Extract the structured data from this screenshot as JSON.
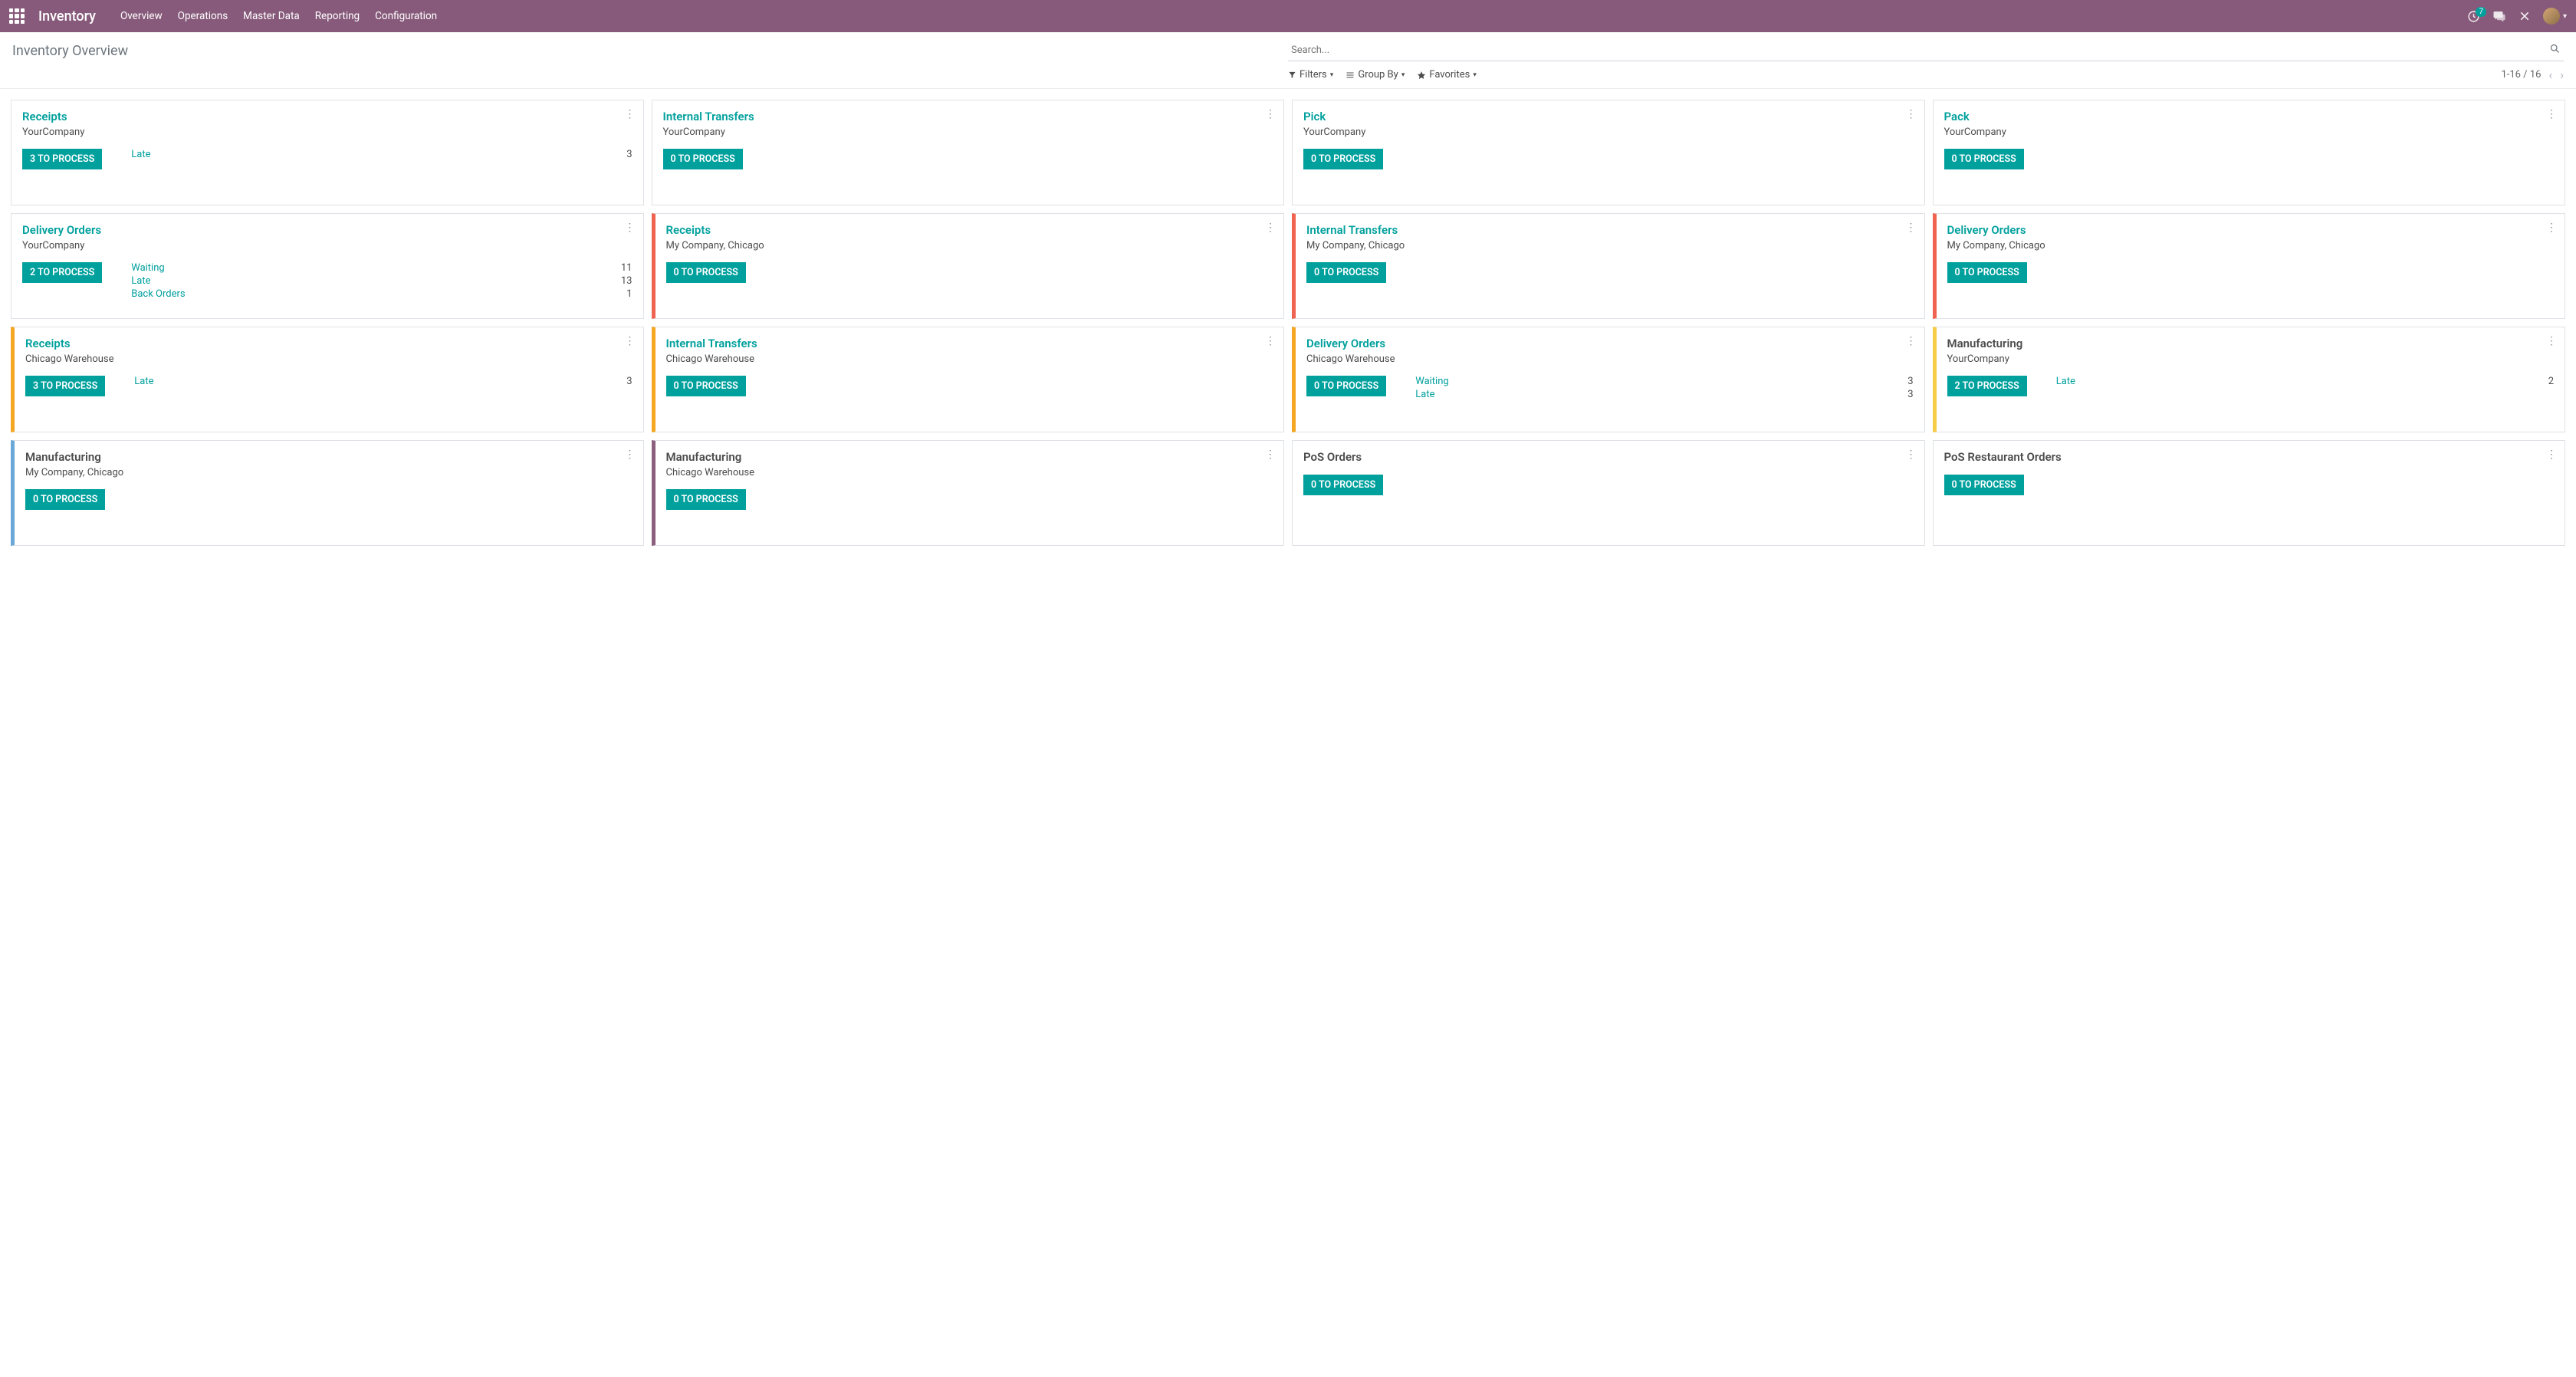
{
  "nav": {
    "brand": "Inventory",
    "menu": [
      "Overview",
      "Operations",
      "Master Data",
      "Reporting",
      "Configuration"
    ],
    "activity_count": "7"
  },
  "control": {
    "breadcrumb": "Inventory Overview",
    "search_placeholder": "Search...",
    "filters": "Filters",
    "groupby": "Group By",
    "favorites": "Favorites",
    "pager": "1-16 / 16"
  },
  "cards": [
    {
      "title": "Receipts",
      "sub": "YourCompany",
      "btn": "3 TO PROCESS",
      "link": true,
      "bar": "",
      "stats": [
        {
          "label": "Late",
          "val": "3"
        }
      ]
    },
    {
      "title": "Internal Transfers",
      "sub": "YourCompany",
      "btn": "0 TO PROCESS",
      "link": true,
      "bar": "",
      "stats": []
    },
    {
      "title": "Pick",
      "sub": "YourCompany",
      "btn": "0 TO PROCESS",
      "link": true,
      "bar": "",
      "stats": []
    },
    {
      "title": "Pack",
      "sub": "YourCompany",
      "btn": "0 TO PROCESS",
      "link": true,
      "bar": "",
      "stats": []
    },
    {
      "title": "Delivery Orders",
      "sub": "YourCompany",
      "btn": "2 TO PROCESS",
      "link": true,
      "bar": "",
      "stats": [
        {
          "label": "Waiting",
          "val": "11"
        },
        {
          "label": "Late",
          "val": "13"
        },
        {
          "label": "Back Orders",
          "val": "1"
        }
      ]
    },
    {
      "title": "Receipts",
      "sub": "My Company, Chicago",
      "btn": "0 TO PROCESS",
      "link": true,
      "bar": "bar-red",
      "stats": []
    },
    {
      "title": "Internal Transfers",
      "sub": "My Company, Chicago",
      "btn": "0 TO PROCESS",
      "link": true,
      "bar": "bar-red",
      "stats": []
    },
    {
      "title": "Delivery Orders",
      "sub": "My Company, Chicago",
      "btn": "0 TO PROCESS",
      "link": true,
      "bar": "bar-red",
      "stats": []
    },
    {
      "title": "Receipts",
      "sub": "Chicago Warehouse",
      "btn": "3 TO PROCESS",
      "link": true,
      "bar": "bar-orange",
      "stats": [
        {
          "label": "Late",
          "val": "3"
        }
      ]
    },
    {
      "title": "Internal Transfers",
      "sub": "Chicago Warehouse",
      "btn": "0 TO PROCESS",
      "link": true,
      "bar": "bar-orange",
      "stats": []
    },
    {
      "title": "Delivery Orders",
      "sub": "Chicago Warehouse",
      "btn": "0 TO PROCESS",
      "link": true,
      "bar": "bar-orange",
      "stats": [
        {
          "label": "Waiting",
          "val": "3"
        },
        {
          "label": "Late",
          "val": "3"
        }
      ]
    },
    {
      "title": "Manufacturing",
      "sub": "YourCompany",
      "btn": "2 TO PROCESS",
      "link": false,
      "bar": "bar-yellow",
      "stats": [
        {
          "label": "Late",
          "val": "2"
        }
      ]
    },
    {
      "title": "Manufacturing",
      "sub": "My Company, Chicago",
      "btn": "0 TO PROCESS",
      "link": false,
      "bar": "bar-blue",
      "stats": []
    },
    {
      "title": "Manufacturing",
      "sub": "Chicago Warehouse",
      "btn": "0 TO PROCESS",
      "link": false,
      "bar": "bar-purple",
      "stats": []
    },
    {
      "title": "PoS Orders",
      "sub": "",
      "btn": "0 TO PROCESS",
      "link": false,
      "bar": "",
      "stats": []
    },
    {
      "title": "PoS Restaurant Orders",
      "sub": "",
      "btn": "0 TO PROCESS",
      "link": false,
      "bar": "",
      "stats": []
    }
  ]
}
